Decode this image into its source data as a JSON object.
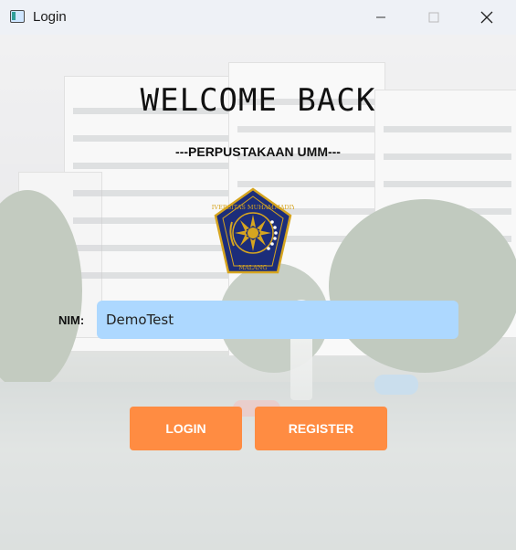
{
  "window": {
    "title": "Login",
    "icon": "app-window-icon",
    "controls": [
      "minimize-icon",
      "maximize-icon",
      "close-icon"
    ]
  },
  "main": {
    "headline": "WELCOME BACK",
    "subtitle": "---PERPUSTAKAAN UMM---",
    "logo": {
      "top_text": "UNIVERSITAS MUHAMMADIYAH",
      "bottom_text": "MALANG"
    },
    "nim": {
      "label": "NIM:",
      "value": "DemoTest"
    },
    "buttons": {
      "login": "LOGIN",
      "register": "REGISTER"
    }
  },
  "colors": {
    "accent_button": "#ff8c42",
    "input_background": "#add8ff",
    "logo_navy": "#1c2d7a",
    "logo_gold": "#d6a520"
  }
}
